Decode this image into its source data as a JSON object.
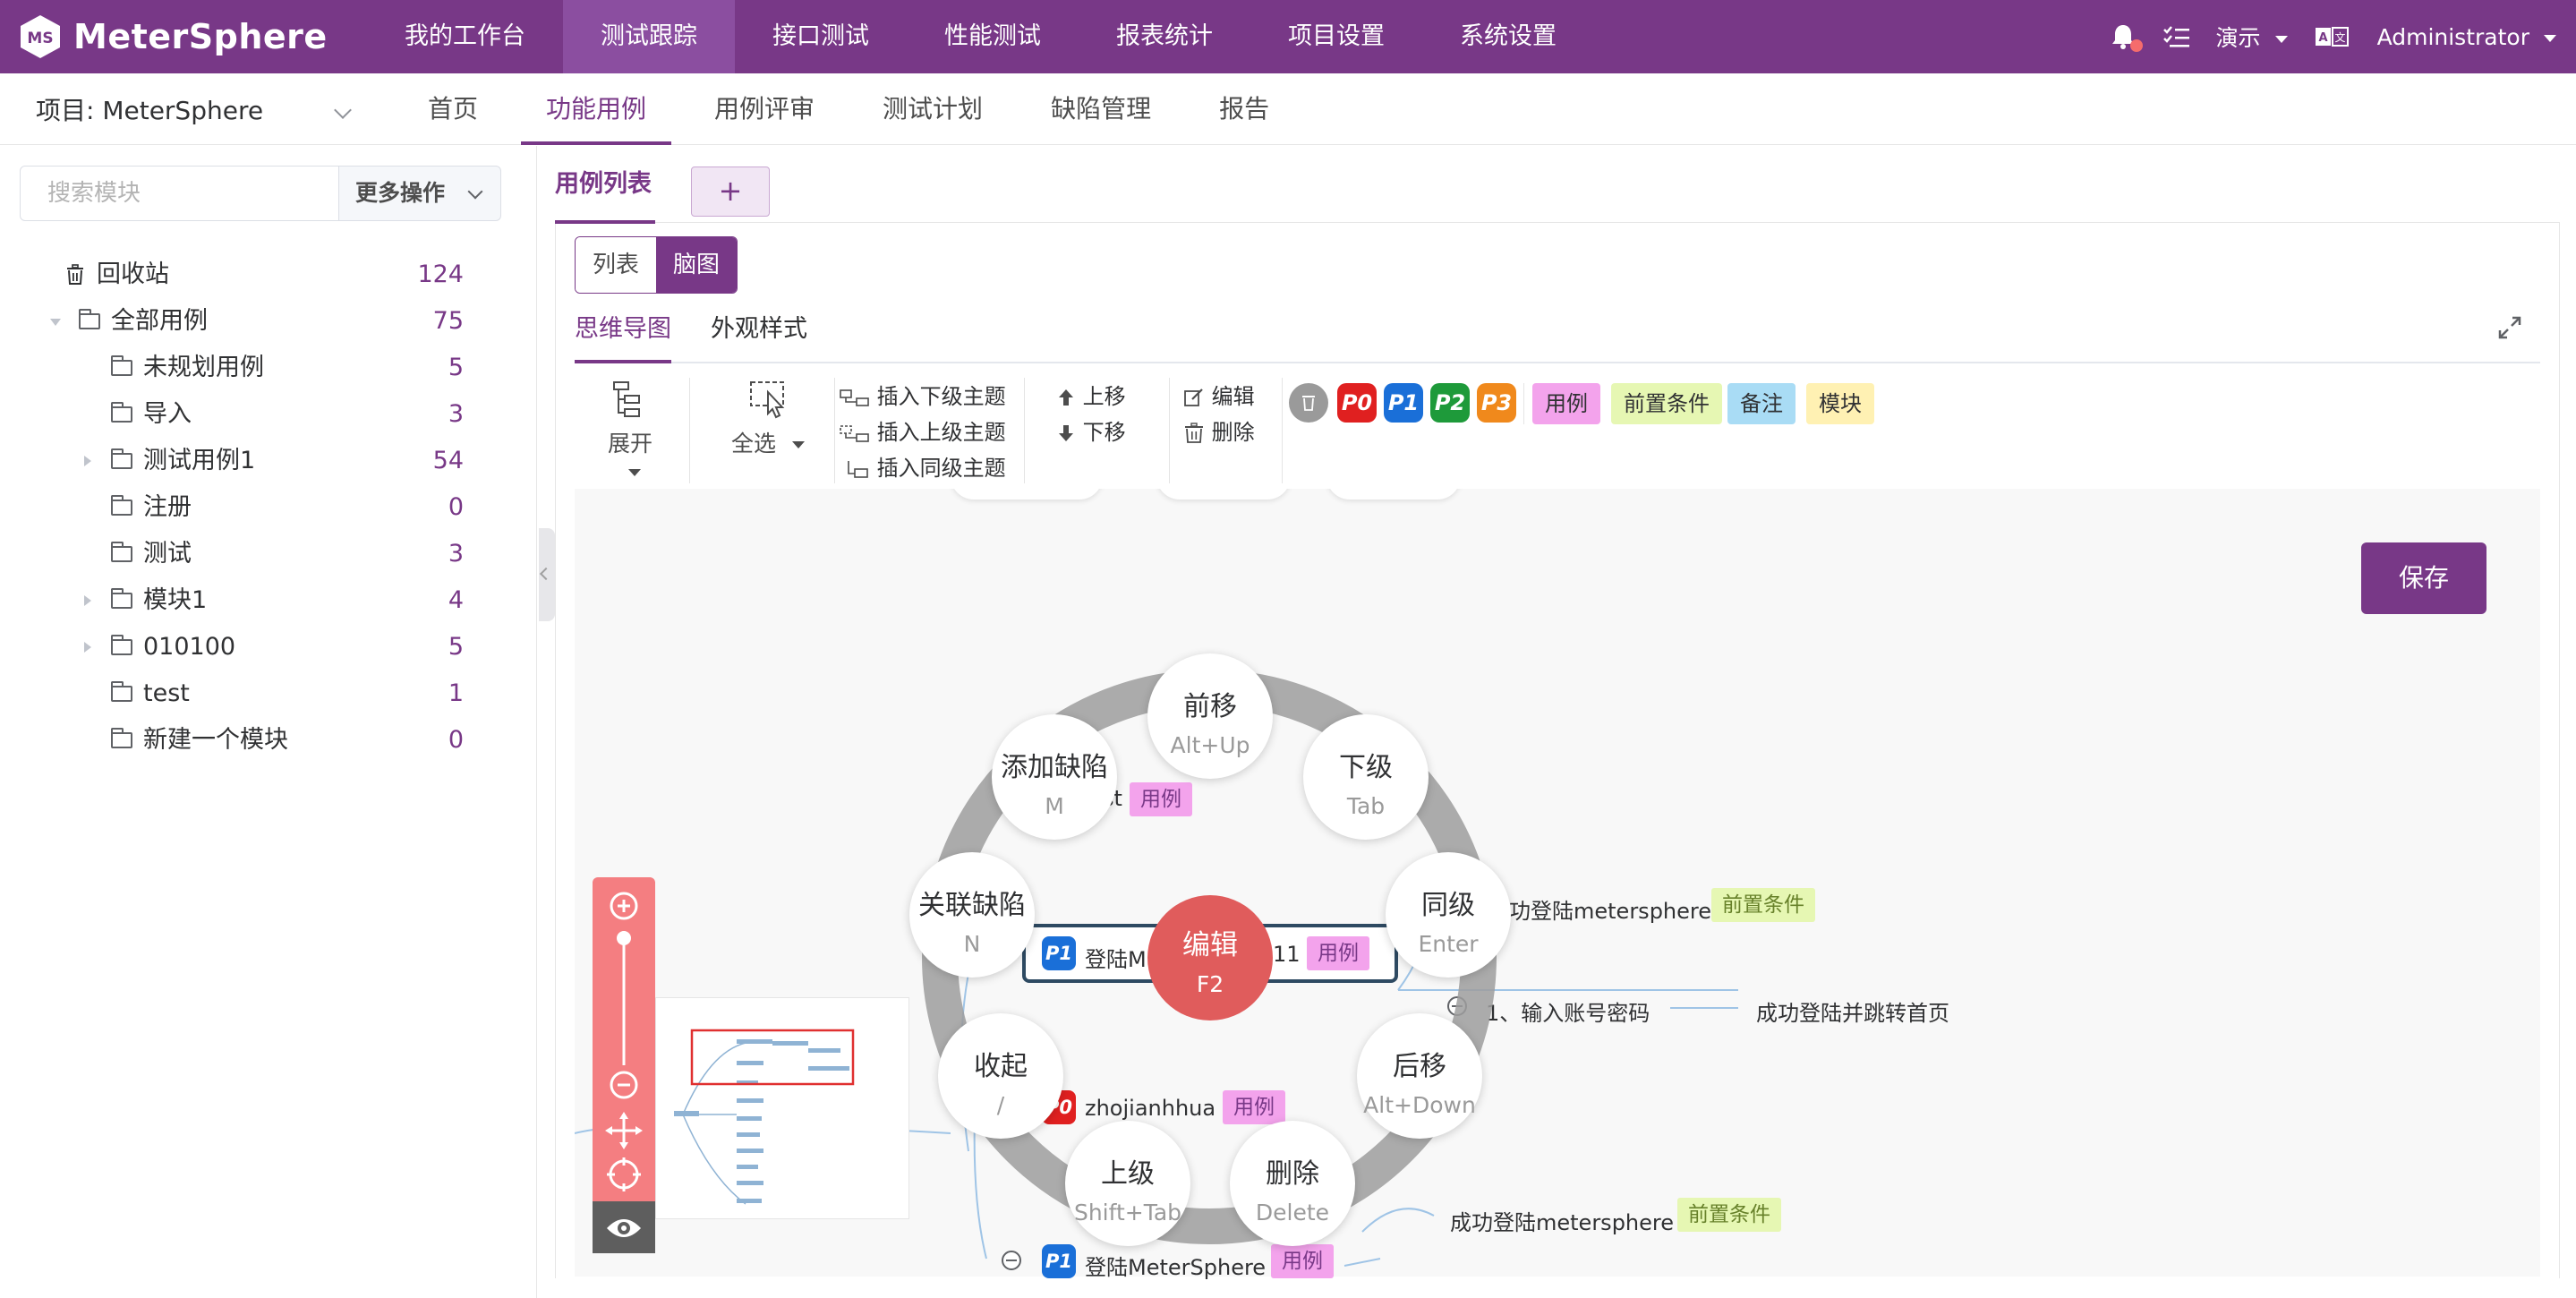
{
  "brand": {
    "name": "MeterSphere"
  },
  "topnav": {
    "items": [
      {
        "label": "我的工作台"
      },
      {
        "label": "测试跟踪"
      },
      {
        "label": "接口测试"
      },
      {
        "label": "性能测试"
      },
      {
        "label": "报表统计"
      },
      {
        "label": "项目设置"
      },
      {
        "label": "系统设置"
      }
    ],
    "workspace": "演示",
    "user": "Administrator"
  },
  "subnav": {
    "project": "项目: MeterSphere",
    "tabs": [
      {
        "label": "首页"
      },
      {
        "label": "功能用例"
      },
      {
        "label": "用例评审"
      },
      {
        "label": "测试计划"
      },
      {
        "label": "缺陷管理"
      },
      {
        "label": "报告"
      }
    ]
  },
  "sidebar": {
    "search_placeholder": "搜索模块",
    "more_label": "更多操作",
    "recycle": {
      "label": "回收站",
      "count": "124"
    },
    "root": {
      "label": "全部用例",
      "count": "75"
    },
    "modules": [
      {
        "label": "未规划用例",
        "count": "5"
      },
      {
        "label": "导入",
        "count": "3"
      },
      {
        "label": "测试用例1",
        "count": "54"
      },
      {
        "label": "注册",
        "count": "0"
      },
      {
        "label": "测试",
        "count": "3"
      },
      {
        "label": "模块1",
        "count": "4"
      },
      {
        "label": "010100",
        "count": "5"
      },
      {
        "label": "test",
        "count": "1"
      },
      {
        "label": "新建一个模块",
        "count": "0"
      }
    ]
  },
  "main": {
    "case_tab": "用例列表",
    "add_tab": "+",
    "view_list": "列表",
    "view_mind": "脑图",
    "mind_tab": "思维导图",
    "style_tab": "外观样式",
    "save": "保存"
  },
  "toolbar": {
    "expand": "展开",
    "select_all": "全选",
    "insert_child": "插入下级主题",
    "insert_parent": "插入上级主题",
    "insert_sibling": "插入同级主题",
    "move_up": "上移",
    "move_down": "下移",
    "edit": "编辑",
    "delete": "删除",
    "priorities": [
      "P0",
      "P1",
      "P2",
      "P3"
    ],
    "tags": [
      "用例",
      "前置条件",
      "备注",
      "模块"
    ]
  },
  "radial_menu": {
    "center": {
      "label": "编辑",
      "key": "F2"
    },
    "items": [
      {
        "label": "前移",
        "key": "Alt+Up"
      },
      {
        "label": "下级",
        "key": "Tab"
      },
      {
        "label": "同级",
        "key": "Enter"
      },
      {
        "label": "后移",
        "key": "Alt+Down"
      },
      {
        "label": "删除",
        "key": "Delete"
      },
      {
        "label": "上级",
        "key": "Shift+Tab"
      },
      {
        "label": "收起",
        "key": "/"
      },
      {
        "label": "关联缺陷",
        "key": "N"
      },
      {
        "label": "添加缺陷",
        "key": "M"
      }
    ]
  },
  "mindmap": {
    "node_st": "st",
    "tag_case": "用例",
    "tag_precondition": "前置条件",
    "selected_prefix": "登陆M",
    "selected_suffix": "11",
    "precondition_text": "功登陆metersphere",
    "step_text": "1、输入账号密码",
    "result_text": "成功登陆并跳转首页",
    "node_zhojian": "zhojianhhua",
    "precondition_text2": "成功登陆metersphere",
    "node_login": "登陆MeterSphere",
    "p0": "P0",
    "p1": "P1"
  },
  "colors": {
    "brand": "#783887",
    "p0": "#e02020",
    "p1": "#1a6fd8",
    "p2": "#1e9a3a",
    "p3": "#f0891c",
    "tag_case": "#f3a3ec",
    "tag_precondition": "#e6f7b3",
    "tag_note": "#a9dcf5",
    "tag_module": "#fff1b3"
  }
}
